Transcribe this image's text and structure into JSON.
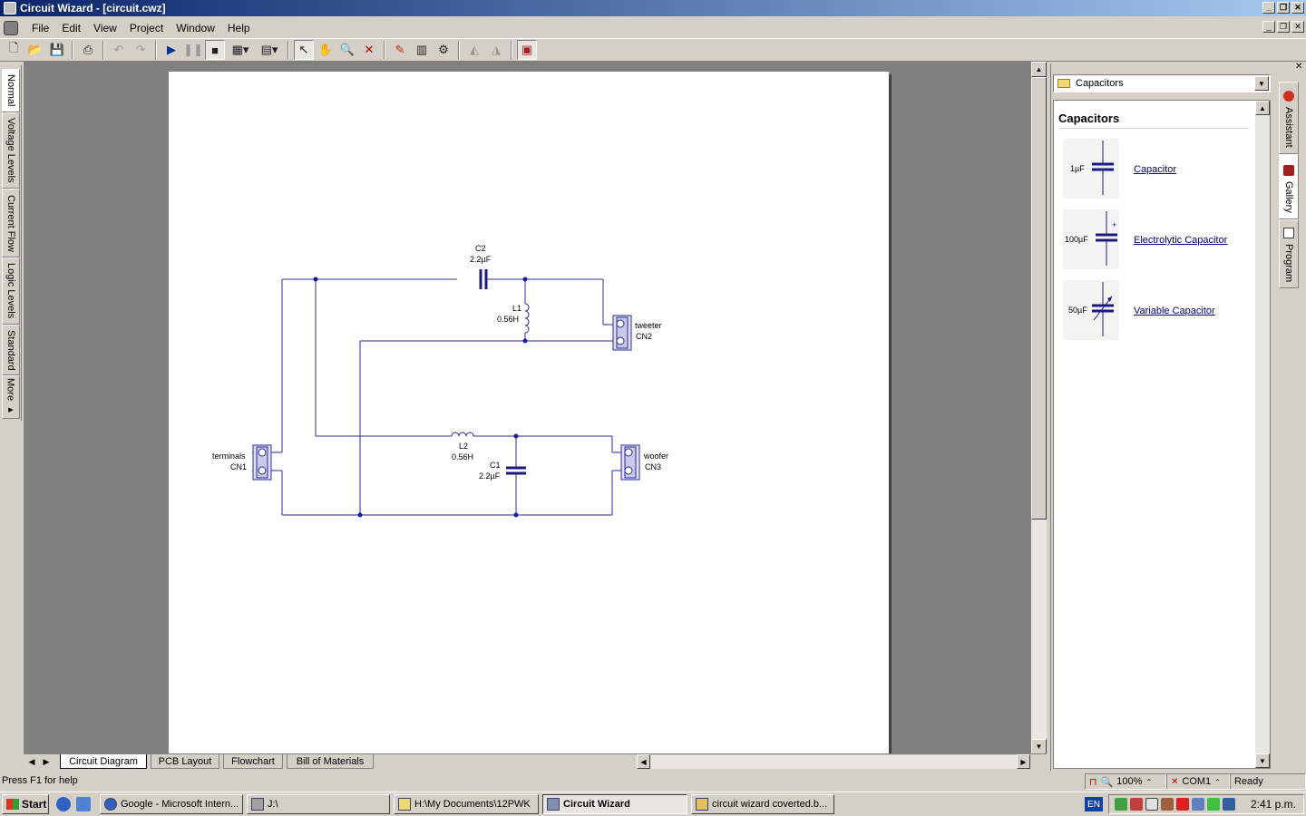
{
  "window": {
    "title": "Circuit Wizard - [circuit.cwz]"
  },
  "menu": [
    "File",
    "Edit",
    "View",
    "Project",
    "Window",
    "Help"
  ],
  "left_tabs": [
    "Normal",
    "Voltage Levels",
    "Current Flow",
    "Logic Levels",
    "Standard",
    "More ▸"
  ],
  "sheet_tabs": [
    "Circuit Diagram",
    "PCB Layout",
    "Flowchart",
    "Bill of Materials"
  ],
  "circuit": {
    "c2_name": "C2",
    "c2_value": "2.2µF",
    "l1_name": "L1",
    "l1_value": "0.56H",
    "l2_name": "L2",
    "l2_value": "0.56H",
    "c1_name": "C1",
    "c1_value": "2.2µF",
    "cn1_label": "terminals",
    "cn1_name": "CN1",
    "cn2_label": "tweeter",
    "cn2_name": "CN2",
    "cn3_label": "woofer",
    "cn3_name": "CN3"
  },
  "gallery": {
    "combo_value": "Capacitors",
    "title": "Capacitors",
    "items": [
      {
        "value": "1µF",
        "name": "Capacitor"
      },
      {
        "value": "100µF",
        "name": "Electrolytic Capacitor"
      },
      {
        "value": "50µF",
        "name": "Variable Capacitor"
      }
    ]
  },
  "right_tabs": [
    "Assistant",
    "Gallery",
    "Program"
  ],
  "status": {
    "help": "Press F1 for help",
    "zoom": "100%",
    "port": "COM1",
    "state": "Ready"
  },
  "taskbar": {
    "start": "Start",
    "tasks": [
      "Google - Microsoft Intern...",
      "J:\\",
      "H:\\My Documents\\12PWK",
      "Circuit Wizard",
      "circuit wizard coverted.b..."
    ],
    "lang": "EN",
    "clock": "2:41 p.m."
  }
}
